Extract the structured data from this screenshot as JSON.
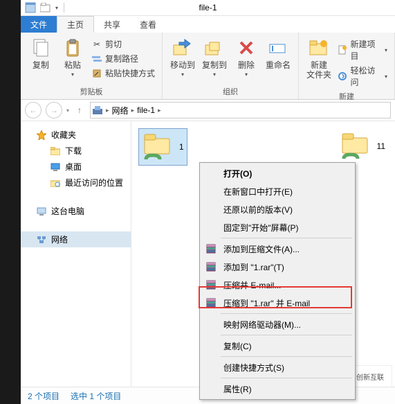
{
  "window": {
    "title": "file-1"
  },
  "qat": {
    "icon1_name": "properties-icon",
    "icon2_name": "new-folder-icon"
  },
  "tabs": {
    "file": "文件",
    "home": "主页",
    "share": "共享",
    "view": "查看"
  },
  "ribbon": {
    "clipboard": {
      "label": "剪贴板",
      "copy": "复制",
      "paste": "粘贴",
      "cut": "剪切",
      "copy_path": "复制路径",
      "paste_shortcut": "粘贴快捷方式"
    },
    "organize": {
      "label": "组织",
      "move_to": "移动到",
      "copy_to": "复制到",
      "delete": "删除",
      "rename": "重命名"
    },
    "new": {
      "label": "新建",
      "new_folder": "新建\n文件夹",
      "new_item": "新建项目",
      "easy_access": "轻松访问"
    }
  },
  "breadcrumb": {
    "items": [
      "网络",
      "file-1"
    ]
  },
  "sidebar": {
    "favorites": "收藏夹",
    "downloads": "下载",
    "desktop": "桌面",
    "recent": "最近访问的位置",
    "this_pc": "这台电脑",
    "network": "网络"
  },
  "content": {
    "items": [
      {
        "label": "1",
        "selected": true
      },
      {
        "label": "11",
        "selected": false
      }
    ]
  },
  "context_menu": {
    "open": "打开(O)",
    "open_new_window": "在新窗口中打开(E)",
    "restore_version": "还原以前的版本(V)",
    "pin_start": "固定到\"开始\"屏幕(P)",
    "add_archive": "添加到压缩文件(A)...",
    "add_1rar": "添加到 \"1.rar\"(T)",
    "compress_email": "压缩并 E-mail...",
    "compress_1rar_email": "压缩到 \"1.rar\" 并 E-mail",
    "map_drive": "映射网络驱动器(M)...",
    "copy": "复制(C)",
    "create_shortcut": "创建快捷方式(S)",
    "properties": "属性(R)"
  },
  "status": {
    "items_count": "2 个项目",
    "selected": "选中 1 个项目"
  },
  "watermark": "创新互联"
}
